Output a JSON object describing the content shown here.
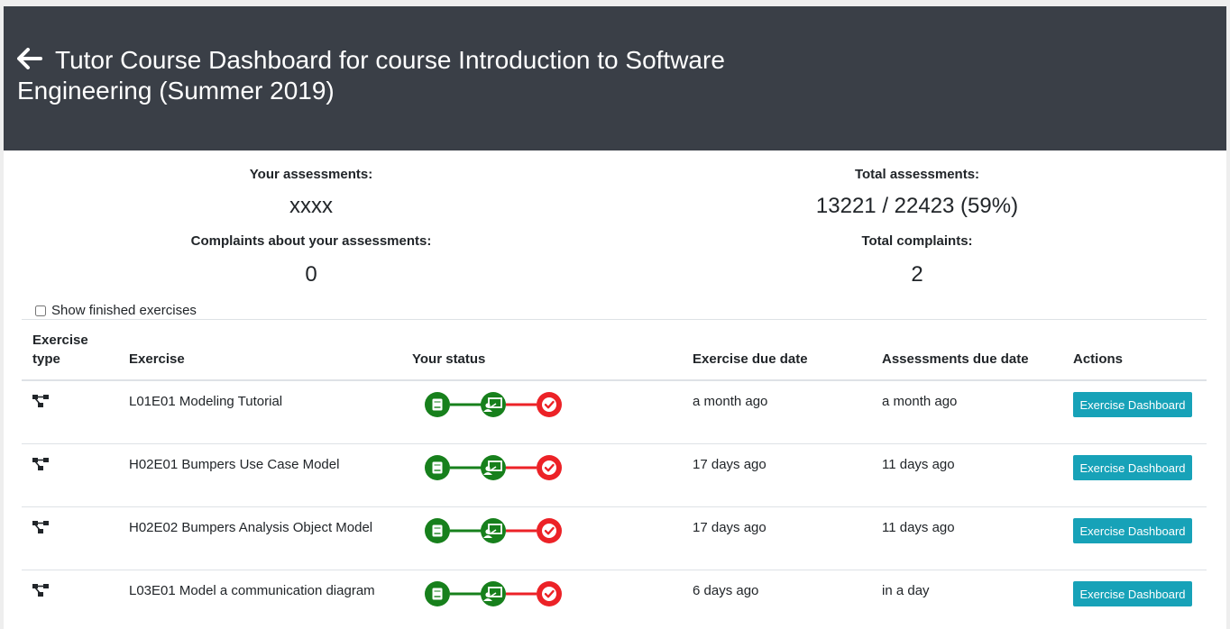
{
  "header": {
    "title": "Tutor Course Dashboard for course Introduction to Software Engineering (Summer 2019)"
  },
  "stats": {
    "your_assessments_label": "Your assessments:",
    "your_assessments_value": "xxxx",
    "your_complaints_label": "Complaints about your assessments:",
    "your_complaints_value": "0",
    "total_assessments_label": "Total assessments:",
    "total_assessments_value": "13221 / 22423 (59%)",
    "total_complaints_label": "Total complaints:",
    "total_complaints_value": "2"
  },
  "filter": {
    "show_finished_label": "Show finished exercises",
    "show_finished_checked": false
  },
  "table": {
    "headers": {
      "type_line1": "Exercise",
      "type_line2": "type",
      "exercise": "Exercise",
      "status": "Your status",
      "due": "Exercise due date",
      "assess_due": "Assessments due date",
      "actions": "Actions"
    },
    "rows": [
      {
        "name": "L01E01 Modeling Tutorial",
        "due": "a month ago",
        "assess_due": "a month ago",
        "action": "Exercise Dashboard"
      },
      {
        "name": "H02E01 Bumpers Use Case Model",
        "due": "17 days ago",
        "assess_due": "11 days ago",
        "action": "Exercise Dashboard"
      },
      {
        "name": "H02E02 Bumpers Analysis Object Model",
        "due": "17 days ago",
        "assess_due": "11 days ago",
        "action": "Exercise Dashboard"
      },
      {
        "name": "L03E01 Model a communication diagram",
        "due": "6 days ago",
        "assess_due": "in a day",
        "action": "Exercise Dashboard"
      }
    ]
  },
  "colors": {
    "header_bg": "#3a3f47",
    "status_done": "#17801c",
    "status_todo": "#ec2227",
    "button": "#17a2b8"
  },
  "icons": {
    "back": "arrow-left-icon",
    "exercise_type": "project-diagram-icon",
    "status_step1": "book-icon",
    "status_step2": "chalkboard-teacher-icon",
    "status_step3": "check-circle-icon"
  }
}
